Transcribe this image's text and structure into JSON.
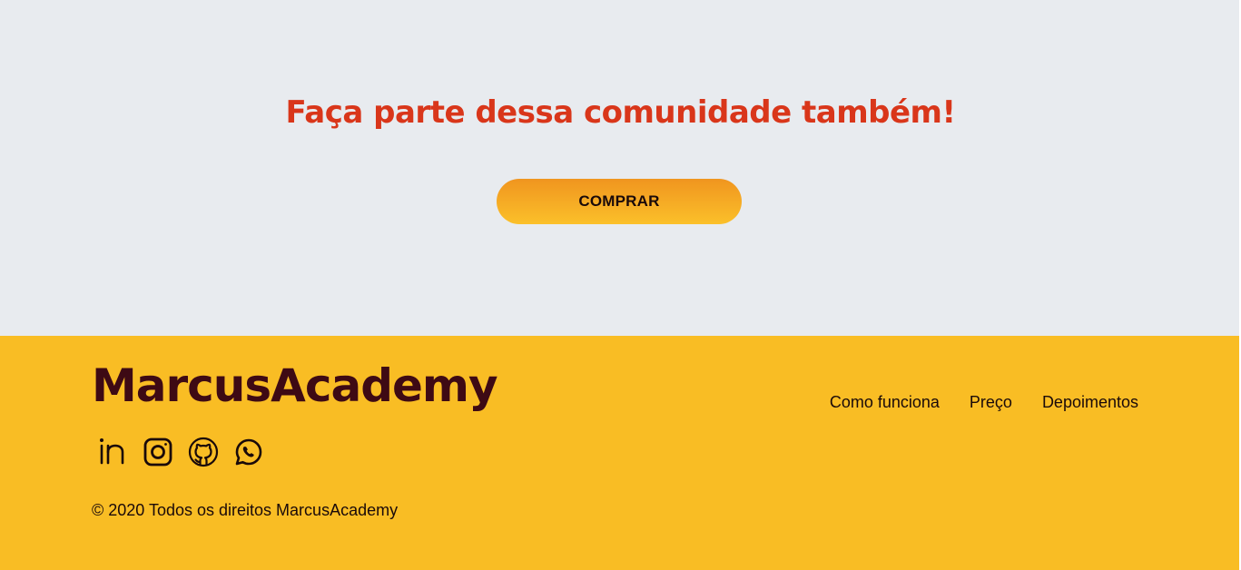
{
  "cta": {
    "title": "Faça parte dessa comunidade também!",
    "button_label": "COMPRAR"
  },
  "footer": {
    "logo": "MarcusAcademy",
    "copyright": "© 2020 Todos os direitos MarcusAcademy",
    "nav": [
      {
        "label": "Como funciona"
      },
      {
        "label": "Preço"
      },
      {
        "label": "Depoimentos"
      }
    ],
    "social": [
      "linkedin-icon",
      "instagram-icon",
      "github-icon",
      "whatsapp-icon"
    ]
  },
  "colors": {
    "cta_background": "#e8ebef",
    "title": "#d9361a",
    "button_gradient_top": "#f0951f",
    "button_gradient_bottom": "#fbc02a",
    "footer_background": "#f9bd24",
    "logo": "#3e0a14"
  }
}
